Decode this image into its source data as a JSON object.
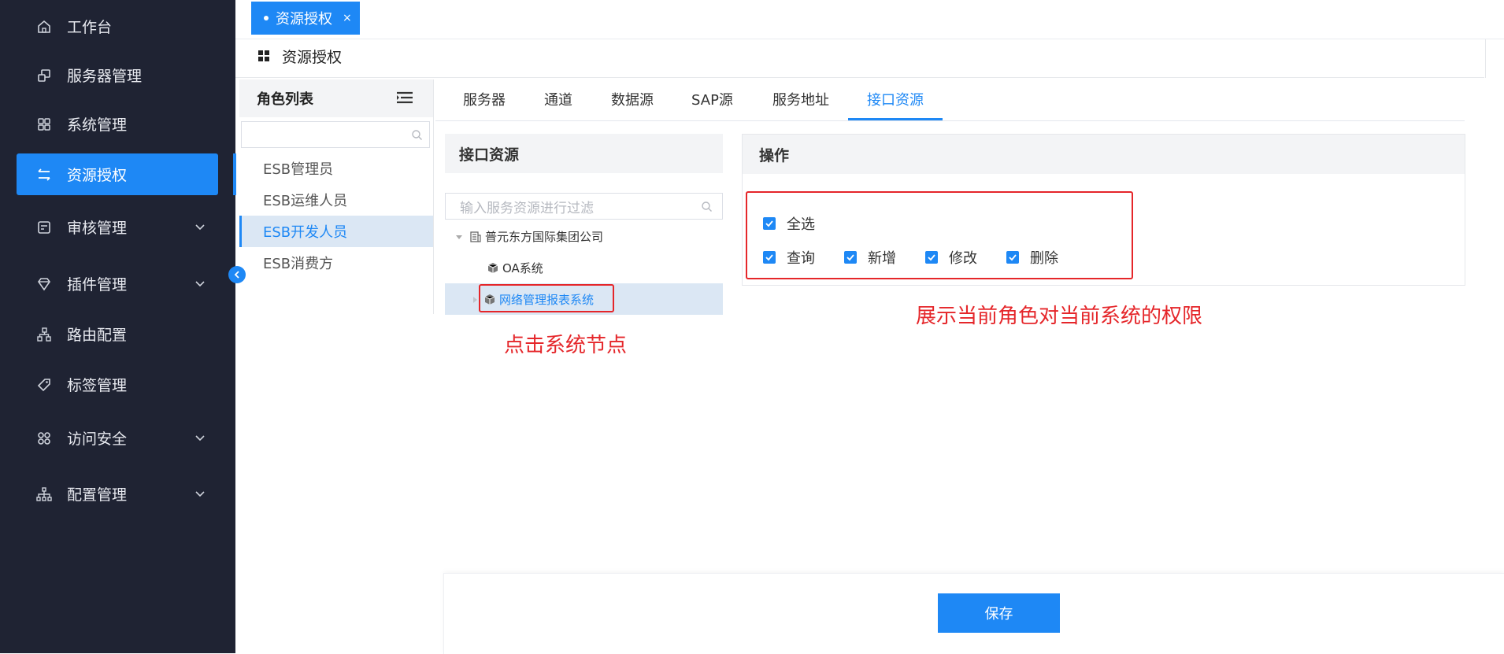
{
  "sidebar": {
    "items": [
      {
        "label": "工作台",
        "icon": "home-icon"
      },
      {
        "label": "服务器管理",
        "icon": "server-icon"
      },
      {
        "label": "系统管理",
        "icon": "grid-icon"
      },
      {
        "label": "资源授权",
        "icon": "transfer-icon",
        "active": true
      },
      {
        "label": "审核管理",
        "icon": "audit-icon",
        "expandable": true
      },
      {
        "label": "插件管理",
        "icon": "diamond-icon",
        "expandable": true
      },
      {
        "label": "路由配置",
        "icon": "route-icon"
      },
      {
        "label": "标签管理",
        "icon": "tag-icon"
      },
      {
        "label": "访问安全",
        "icon": "security-icon",
        "expandable": true
      },
      {
        "label": "配置管理",
        "icon": "config-icon",
        "expandable": true
      }
    ]
  },
  "tabbar": {
    "open_tab": "资源授权",
    "close": "×"
  },
  "breadcrumb": {
    "title": "资源授权"
  },
  "roles": {
    "title": "角色列表",
    "search_placeholder": "",
    "items": [
      "ESB管理员",
      "ESB运维人员",
      "ESB开发人员",
      "ESB消费方"
    ],
    "selected": "ESB开发人员"
  },
  "resource_tabs": {
    "items": [
      "服务器",
      "通道",
      "数据源",
      "SAP源",
      "服务地址",
      "接口资源"
    ],
    "active": "接口资源"
  },
  "tree": {
    "title": "接口资源",
    "filter_placeholder": "输入服务资源进行过滤",
    "root": "普元东方国际集团公司",
    "children": [
      "OA系统",
      "网络管理报表系统"
    ],
    "selected": "网络管理报表系统"
  },
  "ops": {
    "title": "操作",
    "select_all": "全选",
    "permissions": [
      "查询",
      "新增",
      "修改",
      "删除"
    ]
  },
  "annotations": {
    "left": "点击系统节点",
    "right": "展示当前角色对当前系统的权限"
  },
  "footer": {
    "save_label": "保存"
  },
  "colors": {
    "accent": "#1e88f5",
    "sidebar_bg": "#1f2333",
    "annotation": "#e5262a"
  }
}
